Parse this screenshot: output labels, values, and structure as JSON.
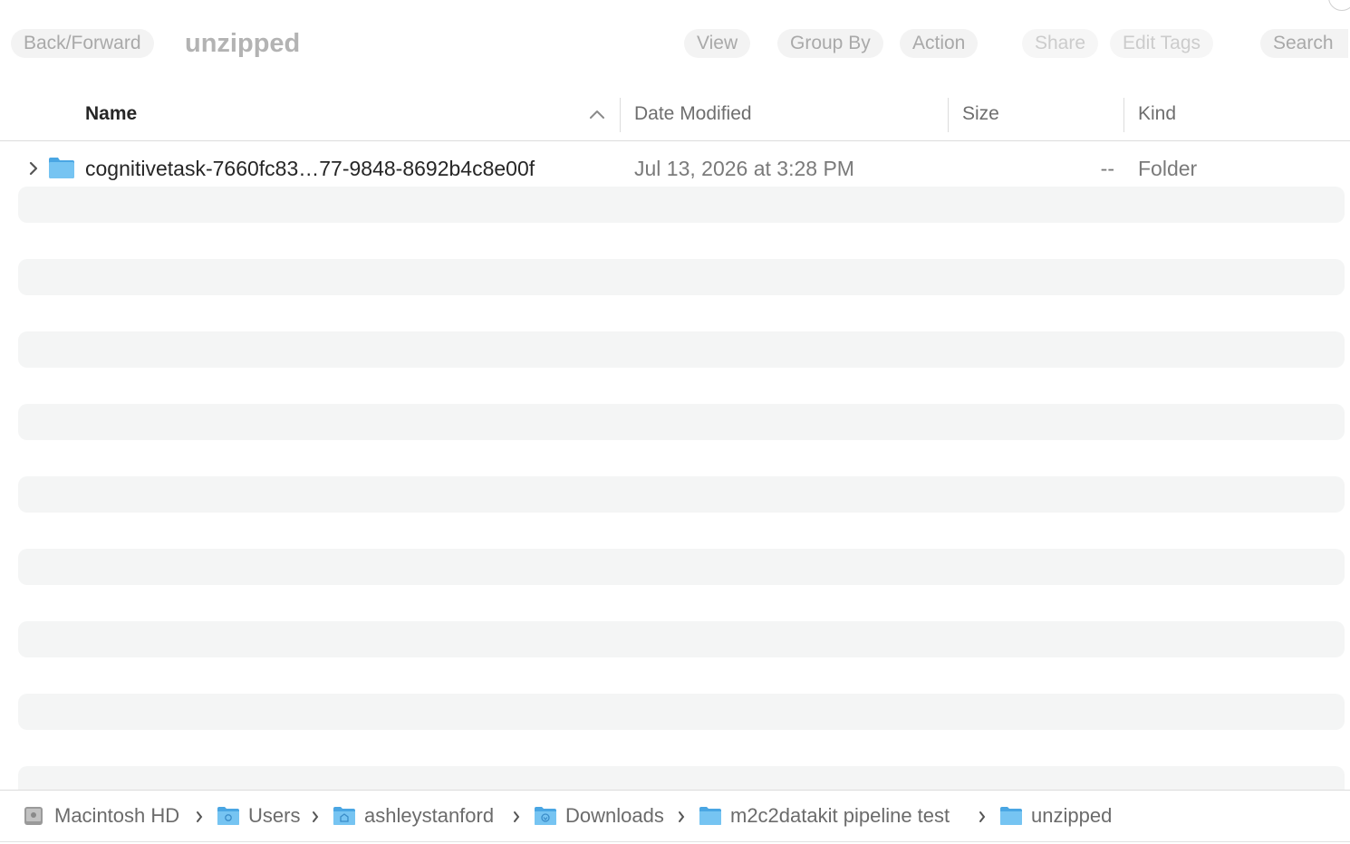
{
  "toolbar": {
    "back_forward": "Back/Forward",
    "title": "unzipped",
    "view": "View",
    "group_by": "Group By",
    "action": "Action",
    "share": "Share",
    "edit_tags": "Edit Tags",
    "search": "Search"
  },
  "columns": {
    "name": "Name",
    "date_modified": "Date Modified",
    "size": "Size",
    "kind": "Kind",
    "sort": "ascending"
  },
  "files": [
    {
      "name": "cognitivetask-7660fc83…77-9848-8692b4c8e00f",
      "date_modified": "Jul 13, 2026 at 3:28 PM",
      "size": "--",
      "kind": "Folder",
      "icon": "folder-icon"
    }
  ],
  "pathbar": [
    {
      "label": "Macintosh HD",
      "icon": "hard-drive-icon"
    },
    {
      "label": "Users",
      "icon": "users-folder-icon"
    },
    {
      "label": "ashleystanford",
      "icon": "home-folder-icon"
    },
    {
      "label": "Downloads",
      "icon": "downloads-folder-icon"
    },
    {
      "label": "m2c2datakit pipeline test",
      "icon": "folder-icon"
    },
    {
      "label": "unzipped",
      "icon": "folder-icon"
    }
  ],
  "colors": {
    "folder_blue": "#5fb8ef",
    "stripe": "#f4f5f5",
    "text_primary": "#262626",
    "text_secondary": "#7a7a7a"
  }
}
